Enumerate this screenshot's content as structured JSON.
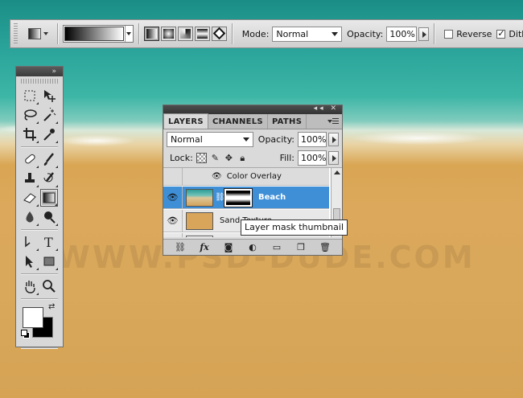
{
  "watermark": "WWW.PSD-DUDE.COM",
  "options_bar": {
    "mode_label": "Mode:",
    "mode_value": "Normal",
    "opacity_label": "Opacity:",
    "opacity_value": "100%",
    "reverse_label": "Reverse",
    "reverse_checked": false,
    "dither_label": "Dithe",
    "dither_checked": true,
    "gradient_types": [
      "linear-gradient",
      "radial-gradient",
      "angle-gradient",
      "reflected-gradient",
      "diamond-gradient"
    ],
    "active_gradient_type": "linear-gradient"
  },
  "toolbox": {
    "tools": [
      [
        "marquee-icon",
        "move-icon"
      ],
      [
        "lasso-icon",
        "magic-wand-icon"
      ],
      [
        "crop-icon",
        "eyedropper-icon"
      ],
      [
        "healing-brush-icon",
        "brush-icon"
      ],
      [
        "clone-stamp-icon",
        "history-brush-icon"
      ],
      [
        "eraser-icon",
        "gradient-icon"
      ],
      [
        "blur-icon",
        "dodge-icon"
      ],
      [
        "pen-icon",
        "type-icon"
      ],
      [
        "path-selection-icon",
        "shape-icon"
      ],
      [
        "hand-icon",
        "zoom-icon"
      ]
    ],
    "active_tool": "gradient-icon",
    "foreground_color": "#ffffff",
    "background_color": "#000000"
  },
  "layers_panel": {
    "tabs": [
      "LAYERS",
      "CHANNELS",
      "PATHS"
    ],
    "active_tab": "LAYERS",
    "blend_mode": "Normal",
    "opacity_label": "Opacity:",
    "opacity_value": "100%",
    "lock_label": "Lock:",
    "fill_label": "Fill:",
    "fill_value": "100%",
    "effect_name": "Color Overlay",
    "layers": [
      {
        "name": "Beach",
        "selected": true,
        "has_mask": true
      },
      {
        "name": "Sand Texture",
        "selected": false,
        "has_mask": false
      }
    ]
  },
  "tooltip": "Layer mask thumbnail",
  "colors": {
    "selection": "#3f8fd7",
    "panel": "#dadada"
  }
}
